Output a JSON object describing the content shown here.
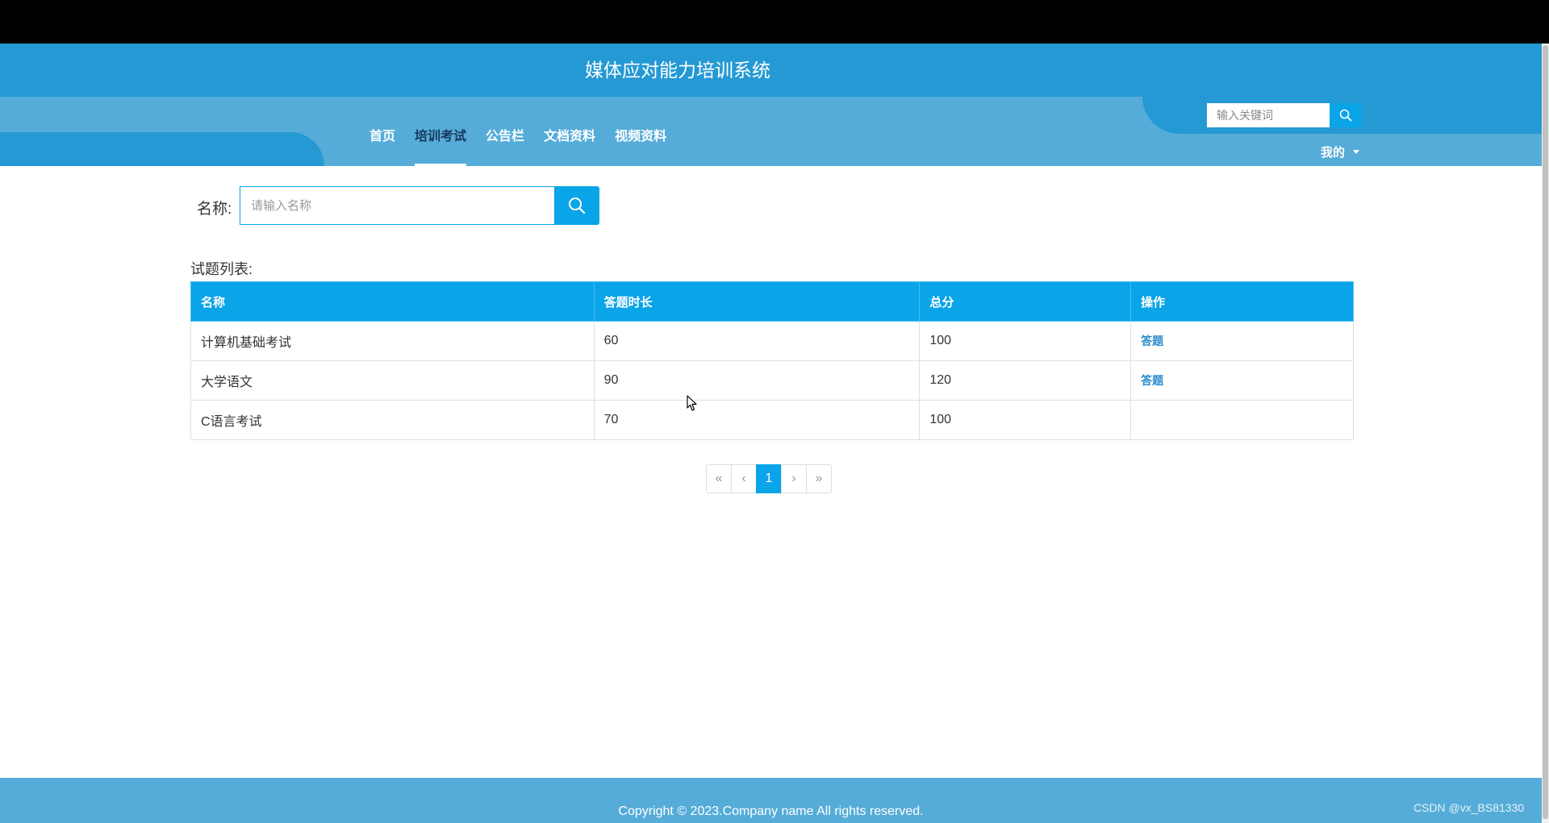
{
  "header": {
    "title": "媒体应对能力培训系统"
  },
  "nav": {
    "items": [
      {
        "label": "首页",
        "active": false
      },
      {
        "label": "培训考试",
        "active": true
      },
      {
        "label": "公告栏",
        "active": false
      },
      {
        "label": "文档资料",
        "active": false
      },
      {
        "label": "视频资料",
        "active": false
      }
    ]
  },
  "top_search": {
    "placeholder": "输入关键词",
    "icon": "search-icon"
  },
  "user_menu": {
    "label": "我的",
    "icon": "caret-down-icon"
  },
  "filter": {
    "name_label": "名称:",
    "name_placeholder": "请输入名称",
    "icon": "search-icon"
  },
  "list": {
    "title": "试题列表:",
    "headers": [
      "名称",
      "答题时长",
      "总分",
      "操作"
    ],
    "rows": [
      {
        "name": "计算机基础考试",
        "duration": "60",
        "score": "100",
        "action": "答题"
      },
      {
        "name": "大学语文",
        "duration": "90",
        "score": "120",
        "action": "答题"
      },
      {
        "name": "C语言考试",
        "duration": "70",
        "score": "100",
        "action": ""
      }
    ]
  },
  "pagination": {
    "first": "«",
    "prev": "‹",
    "current": "1",
    "next": "›",
    "last": "»"
  },
  "footer": {
    "copyright": "Copyright © 2023.Company name All rights reserved."
  },
  "watermark": "CSDN @vx_BS81330",
  "colors": {
    "header_dark": "#2599d4",
    "header_light": "#55acd8",
    "accent": "#0aa4e8",
    "active_nav_text": "#16385a",
    "link": "#2a8ccb"
  }
}
